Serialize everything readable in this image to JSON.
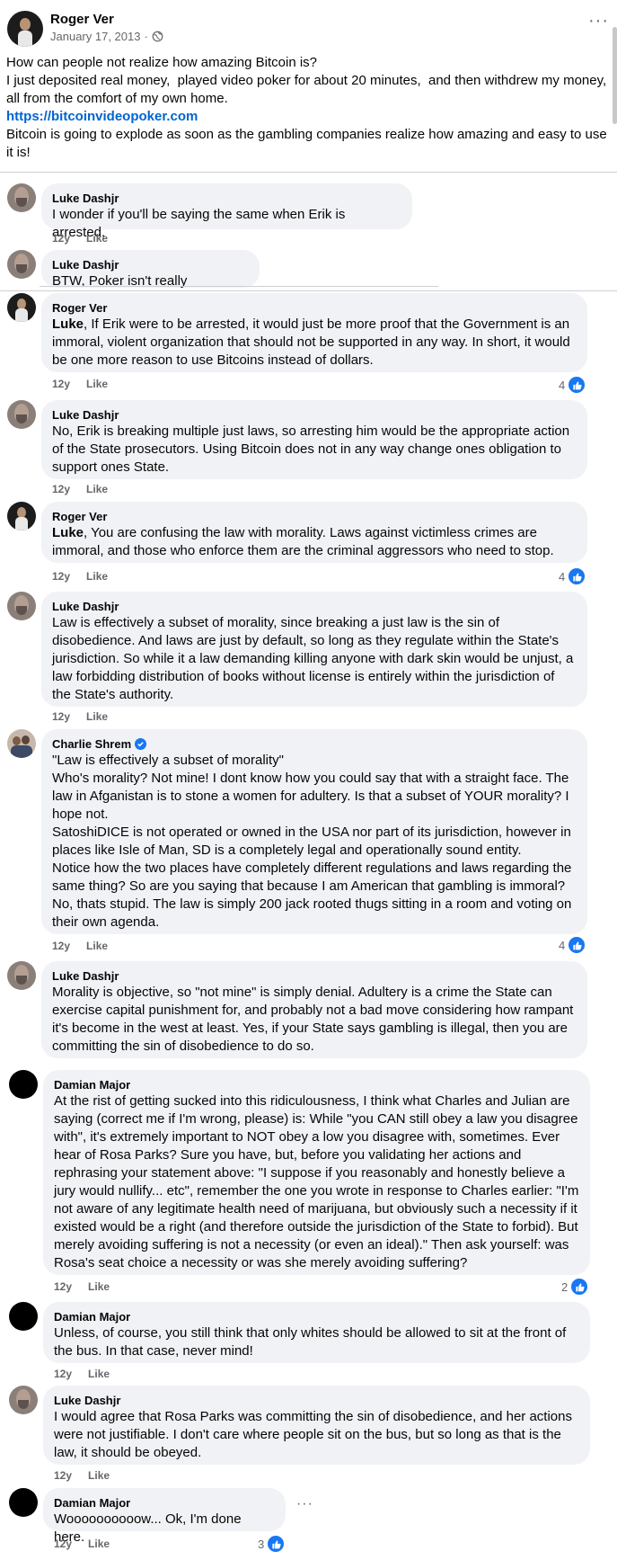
{
  "post": {
    "author": "Roger Ver",
    "date": "January 17, 2013",
    "date_sep": "·",
    "more_icon": "···",
    "lines": [
      "How can people not realize how amazing Bitcoin is?",
      "I just deposited real money,  played video poker for about 20 minutes,  and then withdrew my money, all from the comfort of my own home."
    ],
    "link": "https://bitcoinvideopoker.com",
    "closing": "Bitcoin is going to explode as soon as the gambling companies realize how amazing and easy to use it is!"
  },
  "meta_like": "Like",
  "comments": [
    {
      "author": "Luke Dashjr",
      "avatar": "luke",
      "text": "I wonder if you'll be saying the same when Erik is arrested.",
      "age": "12y",
      "likes": ""
    },
    {
      "author": "Luke Dashjr",
      "avatar": "luke",
      "text": "BTW, Poker isn't really gambling.",
      "age": "",
      "likes": ""
    },
    {
      "author": "Roger Ver",
      "avatar": "roger",
      "mention": "Luke",
      "text": ", If Erik were to be arrested, it would just be more proof that the Government is an immoral, violent organization that should not be supported in any way. In short, it would be one more reason to use Bitcoins instead of dollars.",
      "age": "12y",
      "likes": "4"
    },
    {
      "author": "Luke Dashjr",
      "avatar": "luke",
      "text": "No, Erik is breaking multiple just laws, so arresting him would be the appropriate action of the State prosecutors. Using Bitcoin does not in any way change ones obligation to support ones State.",
      "age": "12y",
      "likes": ""
    },
    {
      "author": "Roger Ver",
      "avatar": "roger",
      "mention": "Luke",
      "text": ", You are confusing the law with morality. Laws against victimless crimes are immoral, and those who enforce them are the criminal aggressors who need to stop.",
      "age": "12y",
      "likes": "4"
    },
    {
      "author": "Luke Dashjr",
      "avatar": "luke",
      "text": "Law is effectively a subset of morality, since breaking a just law is the sin of disobedience. And laws are just by default, so long as they regulate within the State's jurisdiction. So while it a law demanding killing anyone with dark skin would be unjust, a law forbidding distribution of books without license is entirely within the jurisdiction of the State's authority.",
      "age": "12y",
      "likes": ""
    },
    {
      "author": "Charlie Shrem",
      "avatar": "charlie",
      "verified": true,
      "paragraphs": [
        "\"Law is effectively a subset of morality\"",
        "Who's morality? Not mine! I dont know how you could say that with a straight face. The law in Afganistan is to stone a women for adultery. Is that a subset of YOUR morality? I hope not.",
        "SatoshiDICE is not operated or owned in the USA nor part of its jurisdiction, however in places like Isle of Man, SD is a completely legal and operationally sound entity.",
        "Notice how the two places have completely different regulations and laws regarding the same thing? So are you saying that because I am American that gambling is immoral? No, thats stupid. The law is simply 200 jack rooted thugs sitting in a room and voting on their own agenda."
      ],
      "age": "12y",
      "likes": "4"
    },
    {
      "author": "Luke Dashjr",
      "avatar": "luke",
      "text": "Morality is objective, so \"not mine\" is simply denial. Adultery is a crime the State can exercise capital punishment for, and probably not a bad move considering how rampant it's become in the west at least. Yes, if your State says gambling is illegal, then you are committing the sin of disobedience to do so.",
      "age": "",
      "likes": ""
    },
    {
      "author": "Damian Major",
      "avatar": "damian",
      "text": "At the rist of getting sucked into this ridiculousness, I think what Charles and Julian are saying (correct me if I'm wrong, please) is: While \"you CAN still obey a law you disagree with\", it's extremely important to NOT obey a low you disagree with, sometimes. Ever hear of Rosa Parks? Sure you have, but, before you validating her actions and rephrasing your statement above: \"I suppose if you reasonably and honestly believe a jury would nullify... etc\", remember the one you wrote in response to Charles earlier: \"I'm not aware of any legitimate health need of marijuana, but obviously such a necessity if it existed would be a right (and therefore outside the jurisdiction of the State to forbid). But merely avoiding suffering is not a necessity (or even an ideal).\" Then ask yourself: was Rosa's seat choice a necessity or was she merely avoiding suffering?",
      "age": "12y",
      "likes": "2"
    },
    {
      "author": "Damian Major",
      "avatar": "damian",
      "text": "Unless, of course, you still think that only whites should be allowed to sit at the front of the bus. In that case, never mind!",
      "age": "12y",
      "likes": ""
    },
    {
      "author": "Luke Dashjr",
      "avatar": "luke",
      "text": "I would agree that Rosa Parks was committing the sin of disobedience, and her actions were not justifiable. I don't care where people sit on the bus, but so long as that is the law, it should be obeyed.",
      "age": "12y",
      "likes": ""
    },
    {
      "author": "Damian Major",
      "avatar": "damian",
      "text": "Woooooooooow... Ok, I'm done here.",
      "age": "12y",
      "likes": "3",
      "more": "···"
    }
  ],
  "colors": {
    "link": "#0064d1",
    "bubble": "#f0f2f5",
    "like_blue": "#1877f2",
    "meta": "#65676b"
  }
}
